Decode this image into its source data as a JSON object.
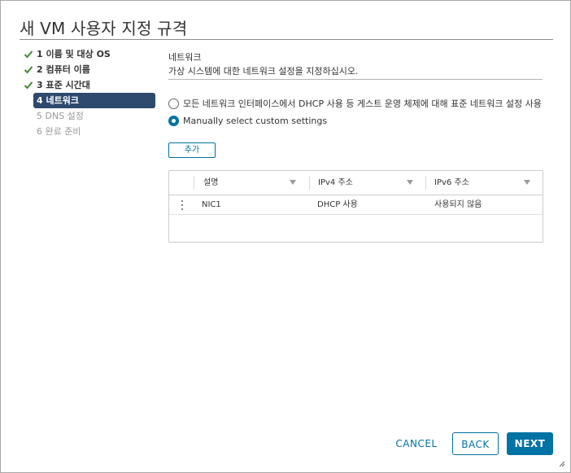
{
  "dialog": {
    "title": "새 VM 사용자 지정 규격"
  },
  "steps": [
    {
      "label": "1 이름 및 대상 OS",
      "state": "done"
    },
    {
      "label": "2 컴퓨터 이름",
      "state": "done"
    },
    {
      "label": "3 표준 시간대",
      "state": "done"
    },
    {
      "label": "4 네트워크",
      "state": "active"
    },
    {
      "label": "5 DNS 설정",
      "state": "disabled"
    },
    {
      "label": "6 완료 준비",
      "state": "disabled"
    }
  ],
  "section": {
    "title": "네트워크",
    "description": "가상 시스템에 대한 네트워크 설정을 지정하십시오."
  },
  "options": {
    "standard": {
      "label": "모든 네트워크 인터페이스에서 DHCP 사용 등 게스트 운영 체제에 대해 표준 네트워크 설정 사용",
      "selected": false
    },
    "custom": {
      "label": "Manually select custom settings",
      "selected": true
    }
  },
  "add_button": "추가",
  "grid": {
    "columns": [
      "설명",
      "IPv4 주소",
      "IPv6 주소"
    ],
    "rows": [
      {
        "description": "NIC1",
        "ipv4": "DHCP 사용",
        "ipv6": "사용되지 않음"
      }
    ]
  },
  "footer": {
    "cancel": "CANCEL",
    "back": "BACK",
    "next": "NEXT"
  },
  "colors": {
    "accent": "#0072a3",
    "active_step": "#2d4a6d",
    "check": "#3d8b2f"
  }
}
